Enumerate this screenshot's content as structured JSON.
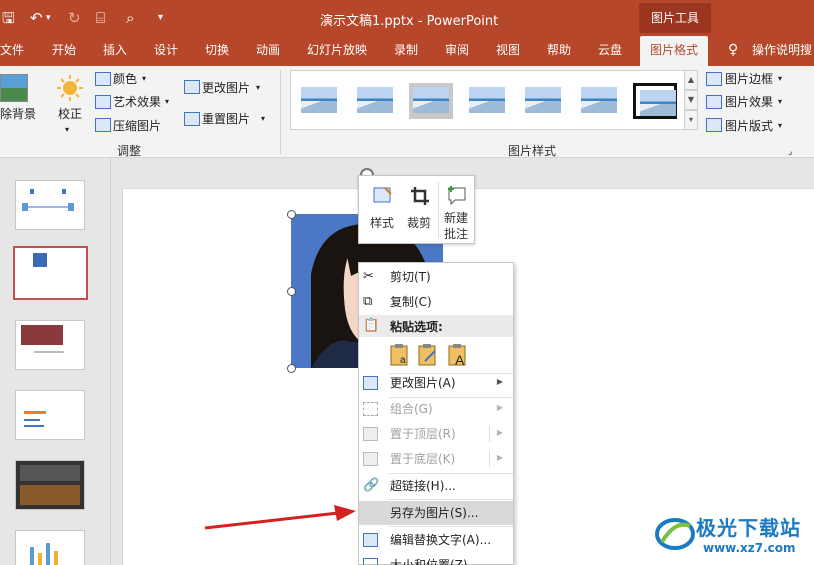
{
  "titlebar": {
    "doc_title": "演示文稿1.pptx  -  PowerPoint",
    "context_group": "图片工具"
  },
  "tabs": [
    {
      "label": "文件"
    },
    {
      "label": "开始"
    },
    {
      "label": "插入"
    },
    {
      "label": "设计"
    },
    {
      "label": "切换"
    },
    {
      "label": "动画"
    },
    {
      "label": "幻灯片放映"
    },
    {
      "label": "录制"
    },
    {
      "label": "审阅"
    },
    {
      "label": "视图"
    },
    {
      "label": "帮助"
    },
    {
      "label": "云盘"
    },
    {
      "label": "图片格式"
    }
  ],
  "tell_me": "操作说明搜",
  "ribbon": {
    "remove_bg": "除背景",
    "corrections": "校正",
    "color": "颜色",
    "artistic": "艺术效果",
    "compress": "压缩图片",
    "change_pic": "更改图片",
    "reset_pic": "重置图片",
    "adjust_group": "调整",
    "styles_group": "图片样式",
    "border": "图片边框",
    "effects": "图片效果",
    "layout": "图片版式"
  },
  "mini_toolbar": {
    "style": "样式",
    "crop": "裁剪",
    "new_comment_1": "新建",
    "new_comment_2": "批注"
  },
  "menu": {
    "cut": "剪切(T)",
    "copy": "复制(C)",
    "paste_options": "粘贴选项:",
    "change_pic": "更改图片(A)",
    "group": "组合(G)",
    "bring_front": "置于顶层(R)",
    "send_back": "置于底层(K)",
    "hyperlink": "超链接(H)...",
    "save_as_pic": "另存为图片(S)...",
    "edit_alt": "编辑替换文字(A)...",
    "size_pos": "大小和位置(Z)..."
  },
  "watermark": {
    "name": "极光下载站",
    "url": "www.xz7.com"
  },
  "colors": {
    "brand": "#b7472a",
    "highlight": "#d9d9d9",
    "arrow": "#d42020"
  }
}
